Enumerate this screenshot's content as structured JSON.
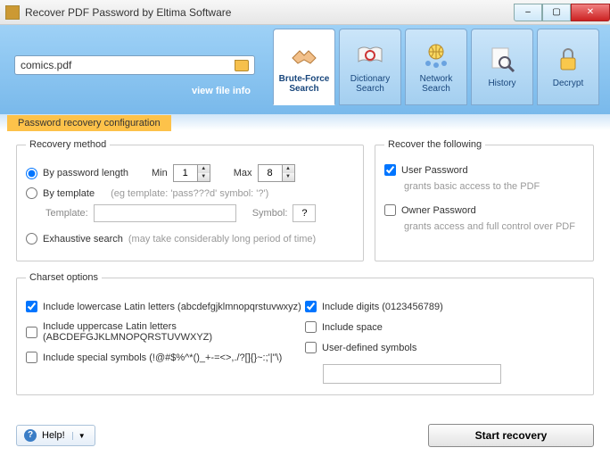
{
  "window": {
    "title": "Recover PDF Password by Eltima Software"
  },
  "header": {
    "filename": "comics.pdf",
    "view_info": "view file info",
    "tabs": [
      {
        "label": "Brute-Force\nSearch"
      },
      {
        "label": "Dictionary\nSearch"
      },
      {
        "label": "Network\nSearch"
      },
      {
        "label": "History"
      },
      {
        "label": "Decrypt"
      }
    ]
  },
  "section_tab": "Password recovery configuration",
  "recovery": {
    "legend": "Recovery method",
    "by_length": "By password length",
    "min_label": "Min",
    "min_value": "1",
    "max_label": "Max",
    "max_value": "8",
    "by_template": "By template",
    "template_hint": "(eg template: 'pass???d' symbol: '?')",
    "template_label": "Template:",
    "symbol_label": "Symbol:",
    "symbol_value": "?",
    "exhaustive": "Exhaustive search",
    "exhaustive_hint": "(may take considerably long period of time)"
  },
  "recover_following": {
    "legend": "Recover the following",
    "user_pw": "User Password",
    "user_pw_hint": "grants basic access to the PDF",
    "owner_pw": "Owner Password",
    "owner_pw_hint": "grants access and full control over PDF"
  },
  "charset": {
    "legend": "Charset options",
    "lowercase": "Include lowercase Latin letters (abcdefgjklmnopqrstuvwxyz)",
    "uppercase": "Include uppercase Latin letters (ABCDEFGJKLMNOPQRSTUVWXYZ)",
    "special": "Include special symbols (!@#$%^*()_+-=<>,./?[]{}~:;'|\"\\)",
    "digits": "Include digits (0123456789)",
    "space": "Include space",
    "user_defined": "User-defined symbols"
  },
  "footer": {
    "help": "Help!",
    "start": "Start recovery"
  }
}
